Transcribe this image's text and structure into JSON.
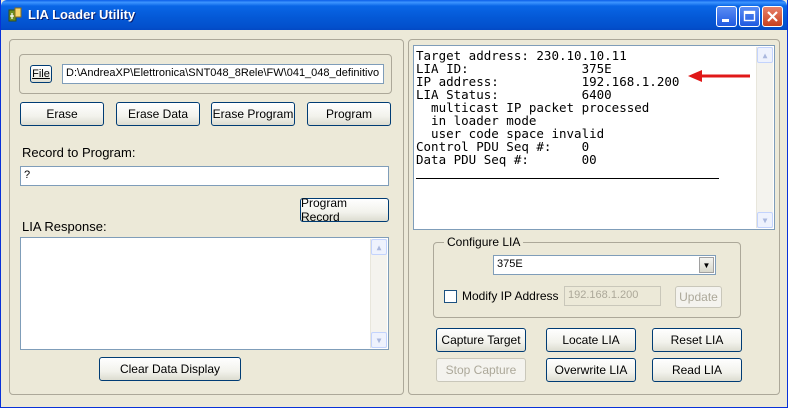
{
  "window": {
    "title": "LIA Loader Utility"
  },
  "file": {
    "button_label": "File",
    "path": "D:\\AndreaXP\\Elettronica\\SNT048_8Rele\\FW\\041_048_definitivo"
  },
  "actions": {
    "erase": "Erase",
    "erase_data": "Erase Data",
    "erase_program": "Erase Program",
    "program": "Program"
  },
  "record": {
    "label": "Record to Program:",
    "value": "?",
    "program_record": "Program Record"
  },
  "response": {
    "label": "LIA Response:",
    "clear": "Clear Data Display"
  },
  "console": {
    "lines": [
      "Target address: 230.10.10.11",
      "LIA ID:               375E",
      "IP address:           192.168.1.200",
      "LIA Status:           6400",
      "  multicast IP packet processed",
      "  in loader mode",
      "  user code space invalid",
      "Control PDU Seq #:    0",
      "Data PDU Seq #:       00"
    ]
  },
  "configure": {
    "group_label": "Configure LIA",
    "selected_lia": "375E",
    "modify_ip_label": "Modify IP Address",
    "ip_value": "192.168.1.200",
    "update": "Update"
  },
  "bottom_buttons": {
    "capture_target": "Capture Target",
    "locate_lia": "Locate LIA",
    "reset_lia": "Reset LIA",
    "stop_capture": "Stop Capture",
    "overwrite_lia": "Overwrite LIA",
    "read_lia": "Read LIA"
  },
  "colors": {
    "titlebar": "#0458d6",
    "arrow": "#e01818",
    "window_bg": "#ece9d8"
  }
}
